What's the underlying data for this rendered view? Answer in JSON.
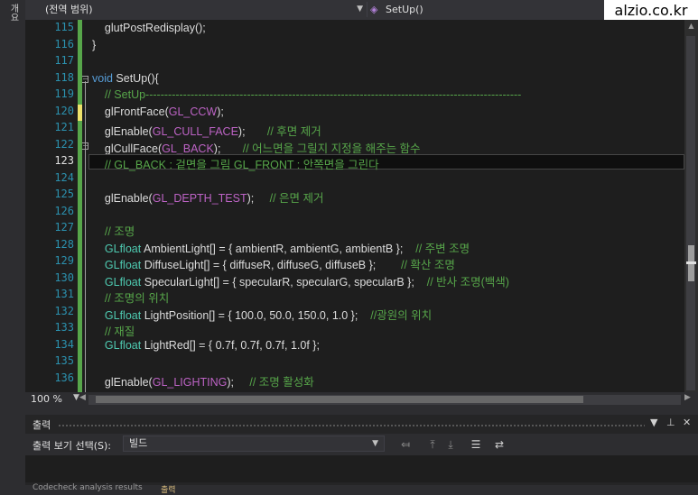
{
  "left_strip": {
    "label": "개요"
  },
  "navbar": {
    "scope": "(전역 범위)",
    "function": "SetUp()"
  },
  "watermark": "alzio.co.kr",
  "editor": {
    "lines": [
      {
        "n": "115",
        "code": [
          {
            "t": "    glutPostRedisplay();",
            "c": ""
          }
        ]
      },
      {
        "n": "116",
        "code": [
          {
            "t": "}",
            "c": ""
          }
        ]
      },
      {
        "n": "117",
        "code": []
      },
      {
        "n": "118",
        "code": [
          {
            "t": "void",
            "c": "c-kw"
          },
          {
            "t": " SetUp(){",
            "c": ""
          }
        ]
      },
      {
        "n": "119",
        "code": [
          {
            "t": "    // SetUp----------------------------------------------------------------------------------------------------",
            "c": "c-com"
          }
        ]
      },
      {
        "n": "120",
        "code": [
          {
            "t": "    glFrontFace(",
            "c": ""
          },
          {
            "t": "GL_CCW",
            "c": "c-mac"
          },
          {
            "t": ");",
            "c": ""
          }
        ]
      },
      {
        "n": "121",
        "code": [
          {
            "t": "    glEnable(",
            "c": ""
          },
          {
            "t": "GL_CULL_FACE",
            "c": "c-mac"
          },
          {
            "t": ");       ",
            "c": ""
          },
          {
            "t": "// 후면 제거",
            "c": "c-com"
          }
        ]
      },
      {
        "n": "122",
        "code": [
          {
            "t": "    glCullFace(",
            "c": ""
          },
          {
            "t": "GL_BACK",
            "c": "c-mac"
          },
          {
            "t": ");       ",
            "c": ""
          },
          {
            "t": "// 어느면을 그릴지 지정을 해주는 함수",
            "c": "c-com"
          }
        ]
      },
      {
        "n": "123",
        "code": [
          {
            "t": "    // GL_BACK : 겉면을 그림 GL_FRONT : 안쪽면을 그린다",
            "c": "c-com"
          }
        ]
      },
      {
        "n": "124",
        "code": []
      },
      {
        "n": "125",
        "code": [
          {
            "t": "    glEnable(",
            "c": ""
          },
          {
            "t": "GL_DEPTH_TEST",
            "c": "c-mac"
          },
          {
            "t": ");     ",
            "c": ""
          },
          {
            "t": "// 은면 제거",
            "c": "c-com"
          }
        ]
      },
      {
        "n": "126",
        "code": []
      },
      {
        "n": "127",
        "code": [
          {
            "t": "    // 조명",
            "c": "c-com"
          }
        ]
      },
      {
        "n": "128",
        "code": [
          {
            "t": "    ",
            "c": ""
          },
          {
            "t": "GLfloat",
            "c": "c-typ"
          },
          {
            "t": " AmbientLight[] = { ambientR, ambientG, ambientB };    ",
            "c": ""
          },
          {
            "t": "// 주변 조명",
            "c": "c-com"
          }
        ]
      },
      {
        "n": "129",
        "code": [
          {
            "t": "    ",
            "c": ""
          },
          {
            "t": "GLfloat",
            "c": "c-typ"
          },
          {
            "t": " DiffuseLight[] = { diffuseR, diffuseG, diffuseB };        ",
            "c": ""
          },
          {
            "t": "// 확산 조명",
            "c": "c-com"
          }
        ]
      },
      {
        "n": "130",
        "code": [
          {
            "t": "    ",
            "c": ""
          },
          {
            "t": "GLfloat",
            "c": "c-typ"
          },
          {
            "t": " SpecularLight[] = { specularR, specularG, specularB };    ",
            "c": ""
          },
          {
            "t": "// 반사 조명(백색)",
            "c": "c-com"
          }
        ]
      },
      {
        "n": "131",
        "code": [
          {
            "t": "    // 조명의 위치",
            "c": "c-com"
          }
        ]
      },
      {
        "n": "132",
        "code": [
          {
            "t": "    ",
            "c": ""
          },
          {
            "t": "GLfloat",
            "c": "c-typ"
          },
          {
            "t": " LightPosition[] = { 100.0, 50.0, 150.0, 1.0 };    ",
            "c": ""
          },
          {
            "t": "//광원의 위치",
            "c": "c-com"
          }
        ]
      },
      {
        "n": "133",
        "code": [
          {
            "t": "    // 재질",
            "c": "c-com"
          }
        ]
      },
      {
        "n": "134",
        "code": [
          {
            "t": "    ",
            "c": ""
          },
          {
            "t": "GLfloat",
            "c": "c-typ"
          },
          {
            "t": " LightRed[] = { 0.7f, 0.7f, 0.7f, 1.0f };",
            "c": ""
          }
        ]
      },
      {
        "n": "135",
        "code": []
      },
      {
        "n": "136",
        "code": [
          {
            "t": "    glEnable(",
            "c": ""
          },
          {
            "t": "GL_LIGHTING",
            "c": "c-mac"
          },
          {
            "t": ");     ",
            "c": ""
          },
          {
            "t": "// 조명 활성화",
            "c": "c-com"
          }
        ]
      }
    ]
  },
  "zoom": {
    "level": "100 %"
  },
  "output": {
    "title": "출력",
    "show_label": "출력 보기 선택(S):",
    "source": "빌드",
    "tab_left": "Codecheck analysis results",
    "tab_active": "출력"
  },
  "colors": {
    "background": "#1e1e1e",
    "comment": "#57a64a",
    "macro": "#bd63c5",
    "type": "#4ec9b0",
    "keyword": "#569cd6",
    "line_number": "#2b91af",
    "changed_saved": "#57a64a",
    "changed_unsaved": "#efe36b"
  },
  "icons": [
    "function-icon",
    "dropdown-arrow-icon",
    "fold-minus-icon",
    "pin-icon",
    "close-icon",
    "word-wrap-icon",
    "clear-all-icon"
  ]
}
